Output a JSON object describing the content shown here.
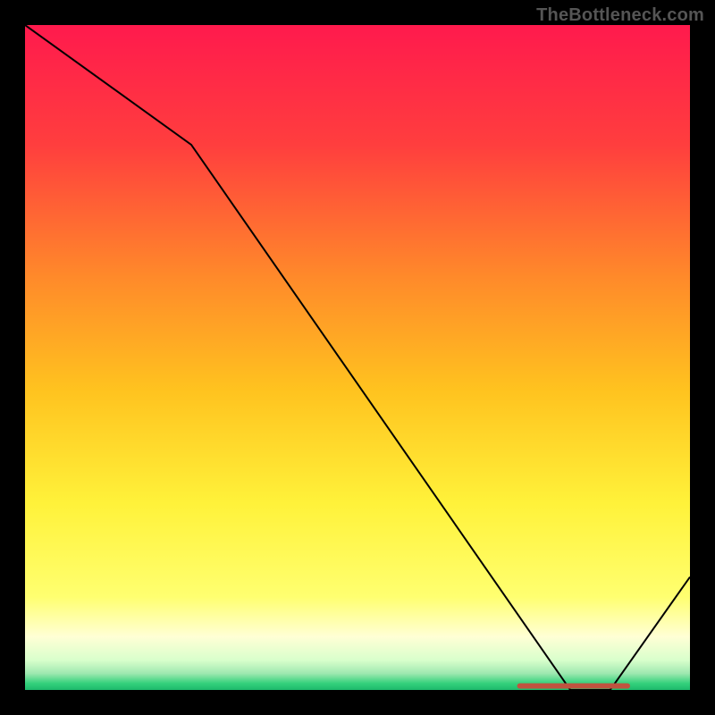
{
  "watermark": "TheBottleneck.com",
  "chart_data": {
    "type": "line",
    "x": [
      0,
      25,
      82,
      88,
      100
    ],
    "values": [
      100,
      82,
      0,
      0,
      17
    ],
    "xlabel": "",
    "ylabel": "",
    "xlim": [
      0,
      100
    ],
    "ylim": [
      0,
      100
    ],
    "title": "",
    "annotations": [
      {
        "text": "",
        "x_start": 74,
        "x_end": 91,
        "y": 0.6,
        "color": "#c0533f"
      }
    ],
    "background_gradient": {
      "stops": [
        {
          "offset": 0.0,
          "color": "#ff1a4d"
        },
        {
          "offset": 0.18,
          "color": "#ff3e3e"
        },
        {
          "offset": 0.38,
          "color": "#ff8a2a"
        },
        {
          "offset": 0.55,
          "color": "#ffc31f"
        },
        {
          "offset": 0.72,
          "color": "#fff23a"
        },
        {
          "offset": 0.86,
          "color": "#ffff70"
        },
        {
          "offset": 0.92,
          "color": "#ffffd5"
        },
        {
          "offset": 0.955,
          "color": "#d9ffcc"
        },
        {
          "offset": 0.975,
          "color": "#9fe8b0"
        },
        {
          "offset": 0.99,
          "color": "#34d17c"
        },
        {
          "offset": 1.0,
          "color": "#1db96b"
        }
      ]
    },
    "line_color": "#000000",
    "line_width": 2
  }
}
